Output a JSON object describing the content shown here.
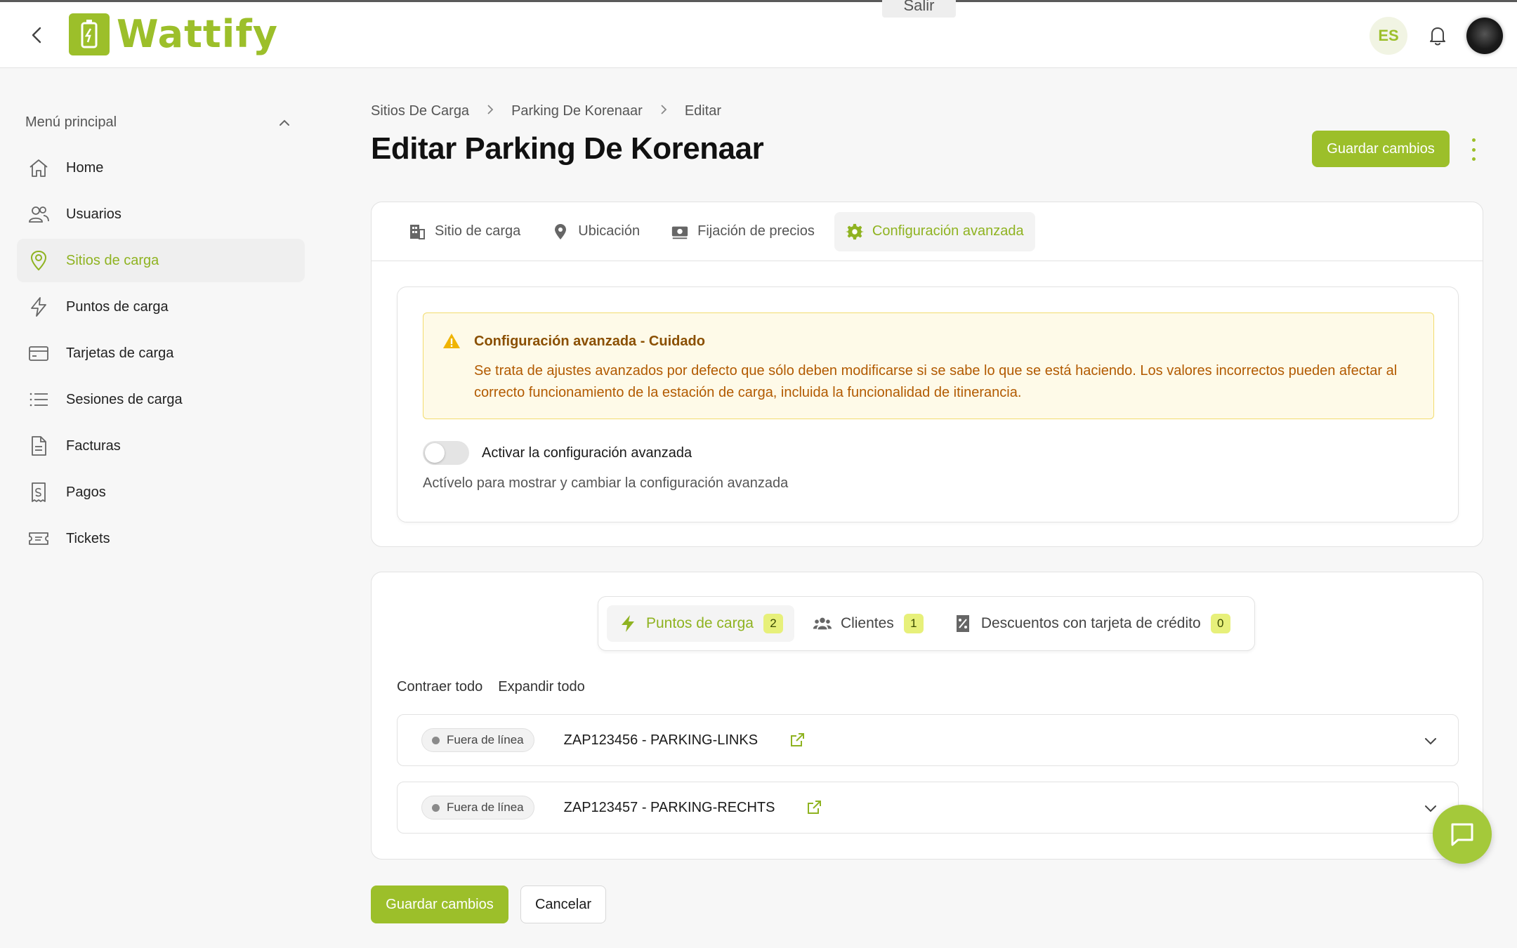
{
  "app": {
    "brand": "Wattify",
    "accent_color": "#9cbf2a"
  },
  "topbar": {
    "ghost_text": "",
    "ghost_button": "Salir",
    "language": "ES"
  },
  "sidebar": {
    "menu_title": "Menú principal",
    "items": [
      {
        "label": "Home",
        "icon": "home-icon",
        "active": false
      },
      {
        "label": "Usuarios",
        "icon": "users-icon",
        "active": false
      },
      {
        "label": "Sitios de carga",
        "icon": "map-pin-icon",
        "active": true
      },
      {
        "label": "Puntos de carga",
        "icon": "lightning-icon",
        "active": false
      },
      {
        "label": "Tarjetas de carga",
        "icon": "credit-card-icon",
        "active": false
      },
      {
        "label": "Sesiones de carga",
        "icon": "list-icon",
        "active": false
      },
      {
        "label": "Facturas",
        "icon": "document-icon",
        "active": false
      },
      {
        "label": "Pagos",
        "icon": "receipt-icon",
        "active": false
      },
      {
        "label": "Tickets",
        "icon": "ticket-icon",
        "active": false
      }
    ]
  },
  "breadcrumb": [
    "Sitios De Carga",
    "Parking De Korenaar",
    "Editar"
  ],
  "page_title": "Editar Parking De Korenaar",
  "actions": {
    "save": "Guardar cambios",
    "cancel": "Cancelar"
  },
  "tabs": [
    {
      "label": "Sitio de carga",
      "icon": "building-icon",
      "active": false
    },
    {
      "label": "Ubicación",
      "icon": "location-icon",
      "active": false
    },
    {
      "label": "Fijación de precios",
      "icon": "money-icon",
      "active": false
    },
    {
      "label": "Configuración avanzada",
      "icon": "gear-icon",
      "active": true
    }
  ],
  "warning": {
    "title": "Configuración avanzada - Cuidado",
    "text": "Se trata de ajustes avanzados por defecto que sólo deben modificarse si se sabe lo que se está haciendo. Los valores incorrectos pueden afectar al correcto funcionamiento de la estación de carga, incluida la funcionalidad de itinerancia."
  },
  "advanced_toggle": {
    "label": "Activar la configuración avanzada",
    "hint": "Actívelo para mostrar y cambiar la configuración avanzada",
    "enabled": false
  },
  "sub_tabs": [
    {
      "label": "Puntos de carga",
      "count": "2",
      "icon": "lightning-icon",
      "active": true
    },
    {
      "label": "Clientes",
      "count": "1",
      "icon": "group-icon",
      "active": false
    },
    {
      "label": "Descuentos con tarjeta de crédito",
      "count": "0",
      "icon": "discount-icon",
      "active": false
    }
  ],
  "collapse_all": "Contraer todo",
  "expand_all": "Expandir todo",
  "charge_points": [
    {
      "status": "Fuera de línea",
      "name": "ZAP123456 - PARKING-LINKS"
    },
    {
      "status": "Fuera de línea",
      "name": "ZAP123457 - PARKING-RECHTS"
    }
  ]
}
